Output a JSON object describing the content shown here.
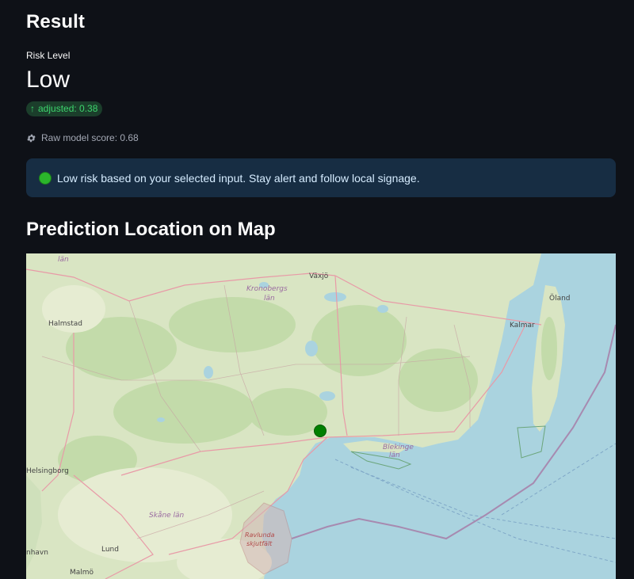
{
  "result": {
    "title": "Result",
    "metric_label": "Risk Level",
    "metric_value": "Low",
    "delta_text": "adjusted: 0.38",
    "raw_score": "Raw model score: 0.68"
  },
  "alert": {
    "message": "Low risk based on your selected input. Stay alert and follow local signage.",
    "icon": "green-circle"
  },
  "map": {
    "title": "Prediction Location on Map",
    "labels": {
      "lan_top": "län",
      "vaxjo": "Växjö",
      "kronobergs": "Kronobergs",
      "kronobergs_lan": "län",
      "oland": "Öland",
      "halmstad": "Halmstad",
      "kalmar": "Kalmar",
      "blekinge": "Blekinge",
      "blekinge_lan": "län",
      "helsingborg": "Helsingborg",
      "skane": "Skåne län",
      "ravlunda": "Ravlunda",
      "skjutfalt": "skjutfält",
      "lund": "Lund",
      "malmo": "Malmö",
      "nhavn": "nhavn"
    },
    "colors": {
      "water": "#aad3df",
      "land": "#d9e5c3",
      "marker": "#008000"
    }
  }
}
